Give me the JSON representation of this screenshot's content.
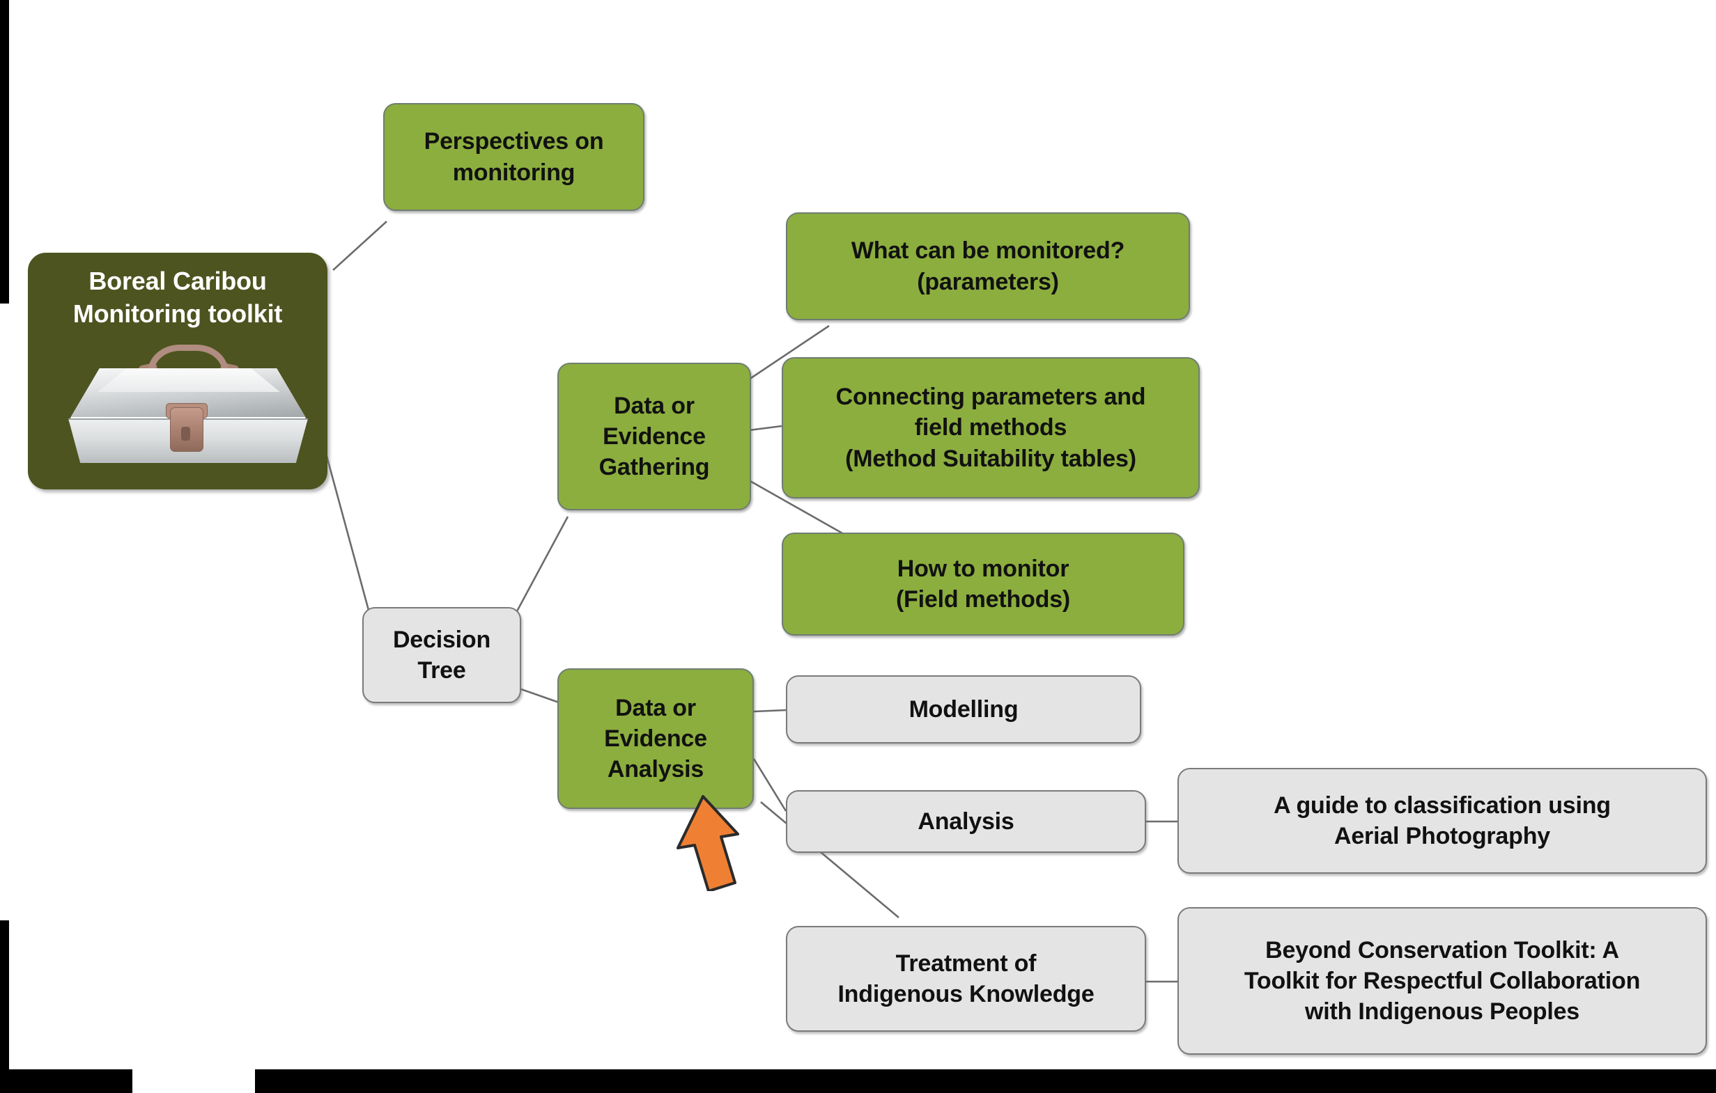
{
  "diagram": {
    "title": "Boreal Caribou Monitoring toolkit mind map",
    "colors": {
      "root_fill": "#4d5420",
      "green_fill": "#8cae3e",
      "grey_fill": "#e4e4e4",
      "arrow": "#ef8033",
      "connector": "#6b6b6b",
      "text_dark": "#111111",
      "text_light": "#ffffff"
    },
    "root": {
      "label_line1": "Boreal Caribou",
      "label_line2": "Monitoring toolkit",
      "icon": "toolbox-illustration"
    },
    "nodes": [
      {
        "id": "perspectives",
        "lines": [
          "Perspectives on",
          "monitoring"
        ],
        "style": "green"
      },
      {
        "id": "what-can-be-monitored",
        "lines": [
          "What can be monitored?",
          "(parameters)"
        ],
        "style": "green"
      },
      {
        "id": "decision-tree",
        "lines": [
          "Decision",
          "Tree"
        ],
        "style": "grey"
      },
      {
        "id": "data-evidence-gathering",
        "lines": [
          "Data or",
          "Evidence",
          "Gathering"
        ],
        "style": "green"
      },
      {
        "id": "connecting-parameters",
        "lines": [
          "Connecting parameters and",
          "field methods",
          "(Method Suitability tables)"
        ],
        "style": "green"
      },
      {
        "id": "how-to-monitor",
        "lines": [
          "How to monitor",
          "(Field methods)"
        ],
        "style": "green"
      },
      {
        "id": "data-evidence-analysis",
        "lines": [
          "Data or",
          "Evidence",
          "Analysis"
        ],
        "style": "green"
      },
      {
        "id": "modelling",
        "lines": [
          "Modelling"
        ],
        "style": "grey"
      },
      {
        "id": "analysis",
        "lines": [
          "Analysis"
        ],
        "style": "grey"
      },
      {
        "id": "aerial-photography-guide",
        "lines": [
          "A guide to classification using",
          "Aerial Photography"
        ],
        "style": "grey"
      },
      {
        "id": "treatment-indigenous-knowledge",
        "lines": [
          "Treatment of",
          "Indigenous Knowledge"
        ],
        "style": "grey"
      },
      {
        "id": "beyond-conservation-toolkit",
        "lines": [
          "Beyond Conservation Toolkit: A",
          "Toolkit for Respectful Collaboration",
          "with Indigenous Peoples"
        ],
        "style": "grey"
      }
    ],
    "annotation": {
      "arrow_icon": "orange-up-arrow",
      "points_to": "data-evidence-analysis"
    }
  }
}
